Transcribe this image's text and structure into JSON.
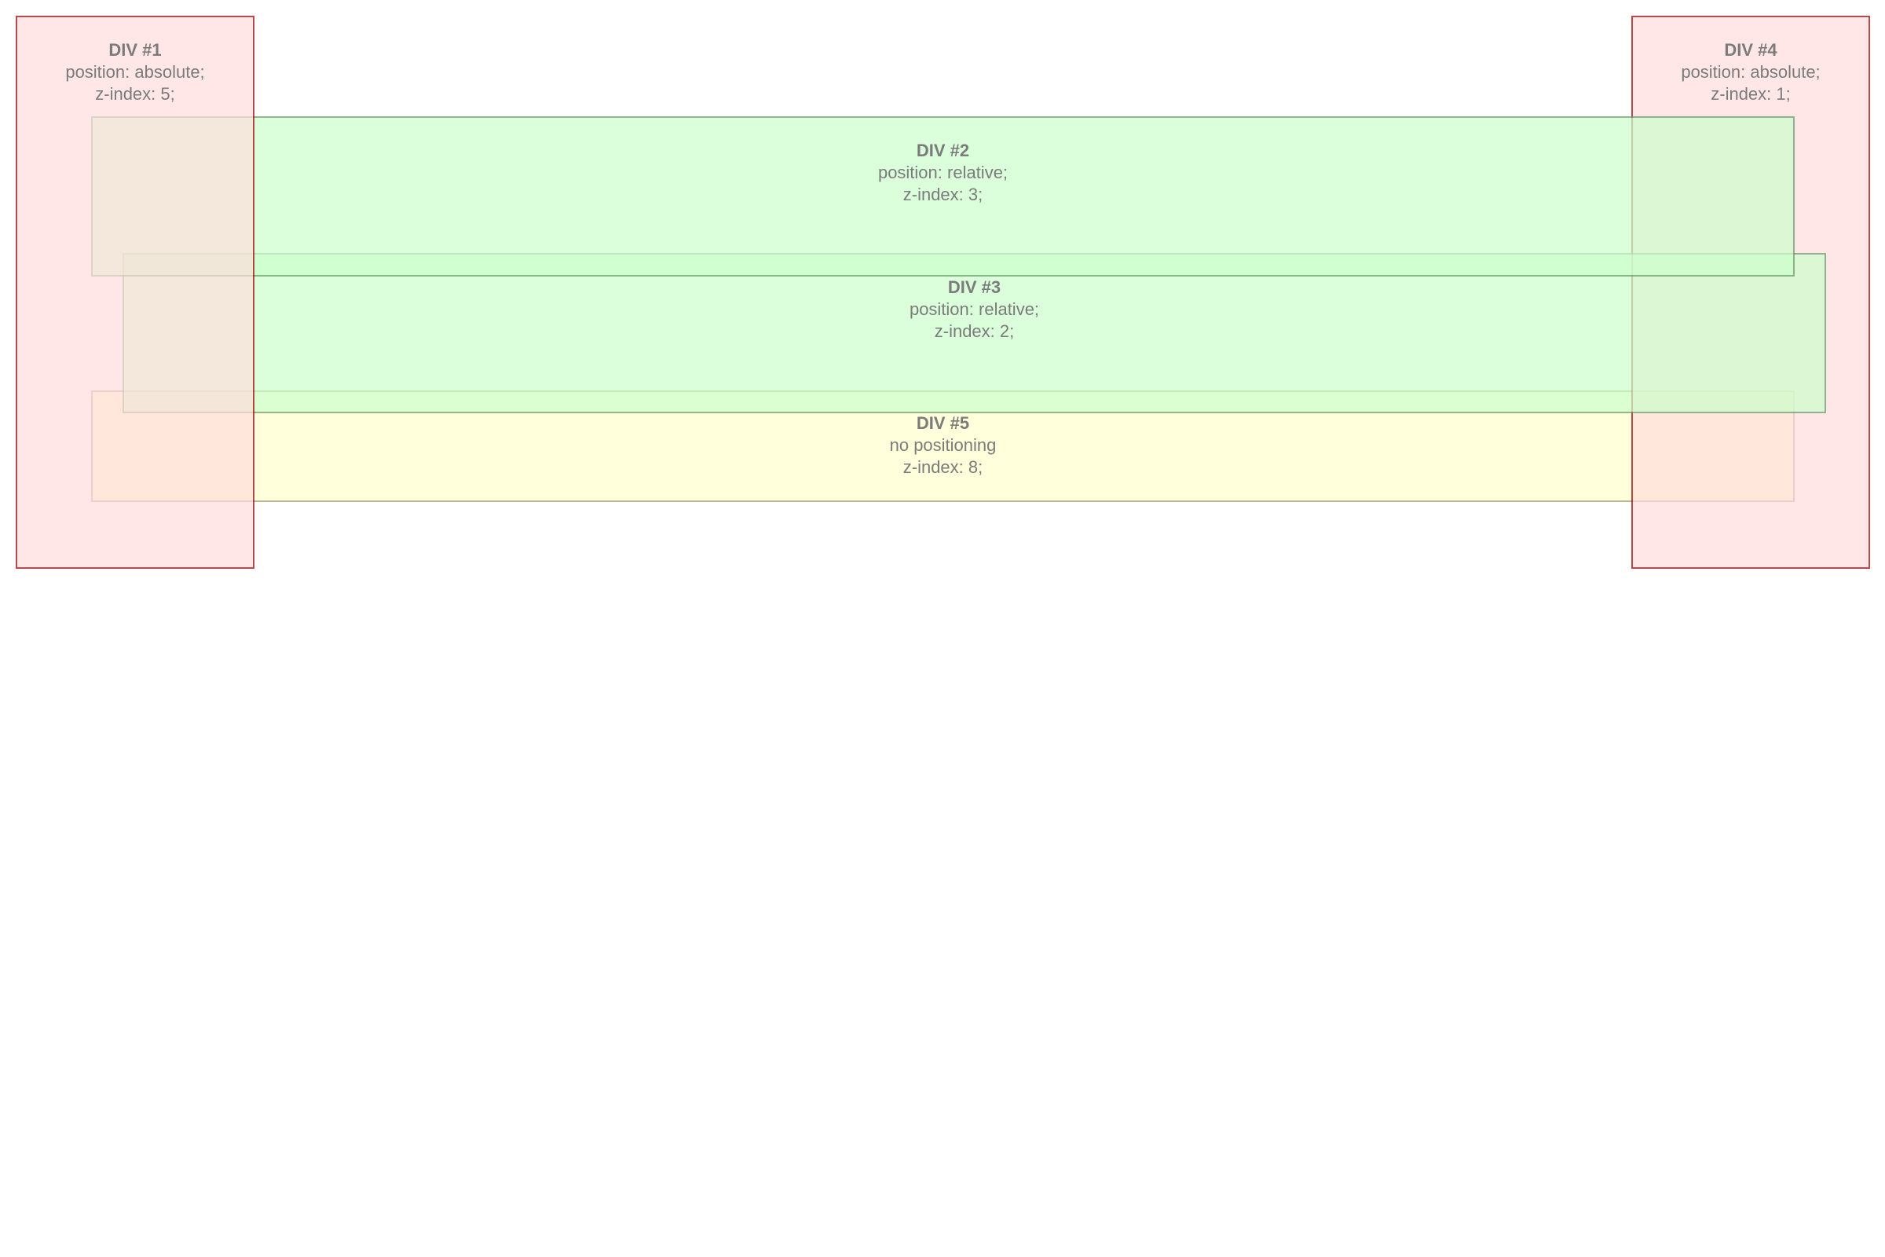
{
  "colors": {
    "absolute_bg": "#FFDDDD",
    "absolute_border": "#990000",
    "relative_bg": "#CCFFCC",
    "relative_border": "#669966",
    "static_bg": "#FFFFCC",
    "static_border": "#999966",
    "text": "#444444"
  },
  "boxes": {
    "div1": {
      "title": "DIV #1",
      "line1": "position: absolute;",
      "line2": "z-index: 5;"
    },
    "div2": {
      "title": "DIV #2",
      "line1": "position: relative;",
      "line2": "z-index: 3;"
    },
    "div3": {
      "title": "DIV #3",
      "line1": "position: relative;",
      "line2": "z-index: 2;"
    },
    "div4": {
      "title": "DIV #4",
      "line1": "position: absolute;",
      "line2": "z-index: 1;"
    },
    "div5": {
      "title": "DIV #5",
      "line1": "no positioning",
      "line2": "z-index: 8;"
    }
  }
}
